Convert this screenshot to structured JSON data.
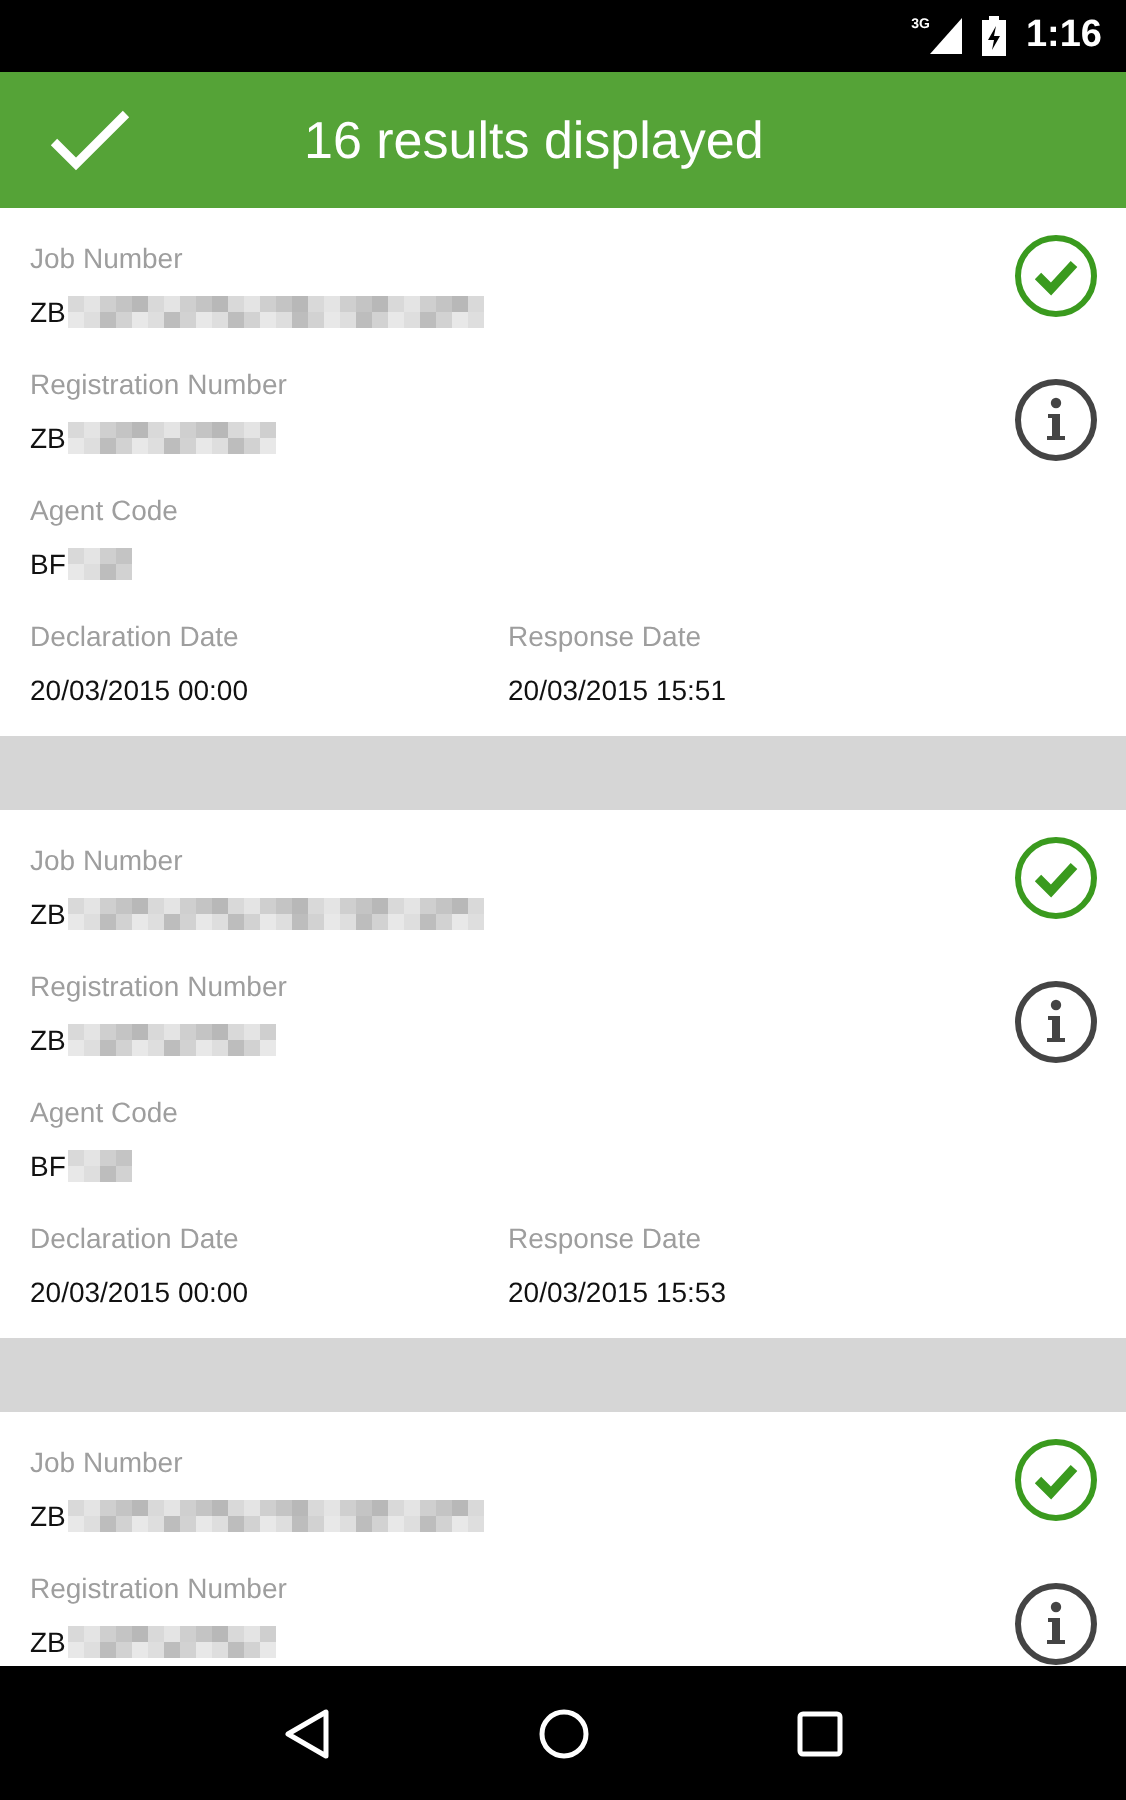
{
  "status_bar": {
    "network": "3G",
    "time": "1:16"
  },
  "app_bar": {
    "title": "16 results displayed"
  },
  "results": [
    {
      "fields": [
        {
          "label": "Job Number",
          "value": "ZB"
        },
        {
          "label": "Registration Number",
          "value": "ZB"
        },
        {
          "label": "Agent Code",
          "value": "BF"
        }
      ],
      "dates": [
        {
          "label": "Declaration Date",
          "value": "20/03/2015 00:00"
        },
        {
          "label": "Response Date",
          "value": "20/03/2015 15:51"
        }
      ]
    },
    {
      "fields": [
        {
          "label": "Job Number",
          "value": "ZB"
        },
        {
          "label": "Registration Number",
          "value": "ZB"
        },
        {
          "label": "Agent Code",
          "value": "BF"
        }
      ],
      "dates": [
        {
          "label": "Declaration Date",
          "value": "20/03/2015 00:00"
        },
        {
          "label": "Response Date",
          "value": "20/03/2015 15:53"
        }
      ]
    },
    {
      "fields": [
        {
          "label": "Job Number",
          "value": "ZB"
        },
        {
          "label": "Registration Number",
          "value": "ZB"
        }
      ]
    }
  ]
}
